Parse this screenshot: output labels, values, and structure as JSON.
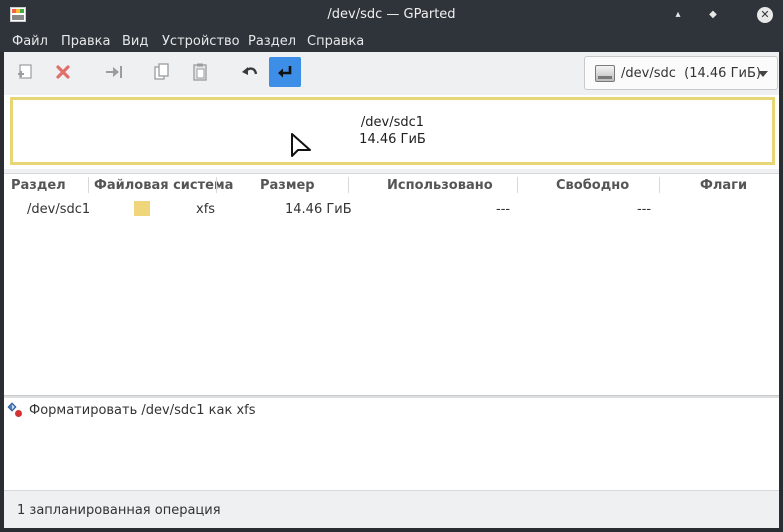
{
  "window": {
    "title": "/dev/sdc — GParted",
    "buttons": {
      "minimize": "▴",
      "maximize": "◆",
      "close": "✕"
    }
  },
  "menu": {
    "items": [
      "Файл",
      "Правка",
      "Вид",
      "Устройство",
      "Раздел",
      "Справка"
    ]
  },
  "toolbar": {
    "buttons": [
      {
        "icon": "new-partition-icon",
        "enabled": false
      },
      {
        "icon": "delete-icon",
        "enabled": false
      },
      {
        "icon": "resize-move-icon",
        "enabled": false
      },
      {
        "icon": "copy-icon",
        "enabled": false
      },
      {
        "icon": "paste-icon",
        "enabled": false
      },
      {
        "icon": "undo-icon",
        "enabled": true
      },
      {
        "icon": "apply-icon",
        "enabled": true,
        "active": true
      }
    ],
    "device": {
      "path": "/dev/sdc",
      "size": "(14.46 ГиБ)"
    }
  },
  "map": {
    "partition_name": "/dev/sdc1",
    "partition_size": "14.46 ГиБ",
    "color": "#e8d575"
  },
  "table": {
    "headers": [
      "Раздел",
      "Файловая система",
      "Размер",
      "Использовано",
      "Свободно",
      "Флаги"
    ],
    "rows": [
      {
        "partition": "/dev/sdc1",
        "filesystem": "xfs",
        "fs_color": "#f0d67a",
        "size": "14.46 ГиБ",
        "used": "---",
        "free": "---",
        "flags": ""
      }
    ]
  },
  "operations": {
    "items": [
      {
        "icon": "format-operation-icon",
        "text": "Форматировать /dev/sdc1 как xfs"
      }
    ]
  },
  "status": {
    "text": "1 запланированная операция"
  },
  "colors": {
    "accent": "#3d8ee6",
    "titlebar": "#2f343a",
    "xfs": "#f0d67a"
  }
}
